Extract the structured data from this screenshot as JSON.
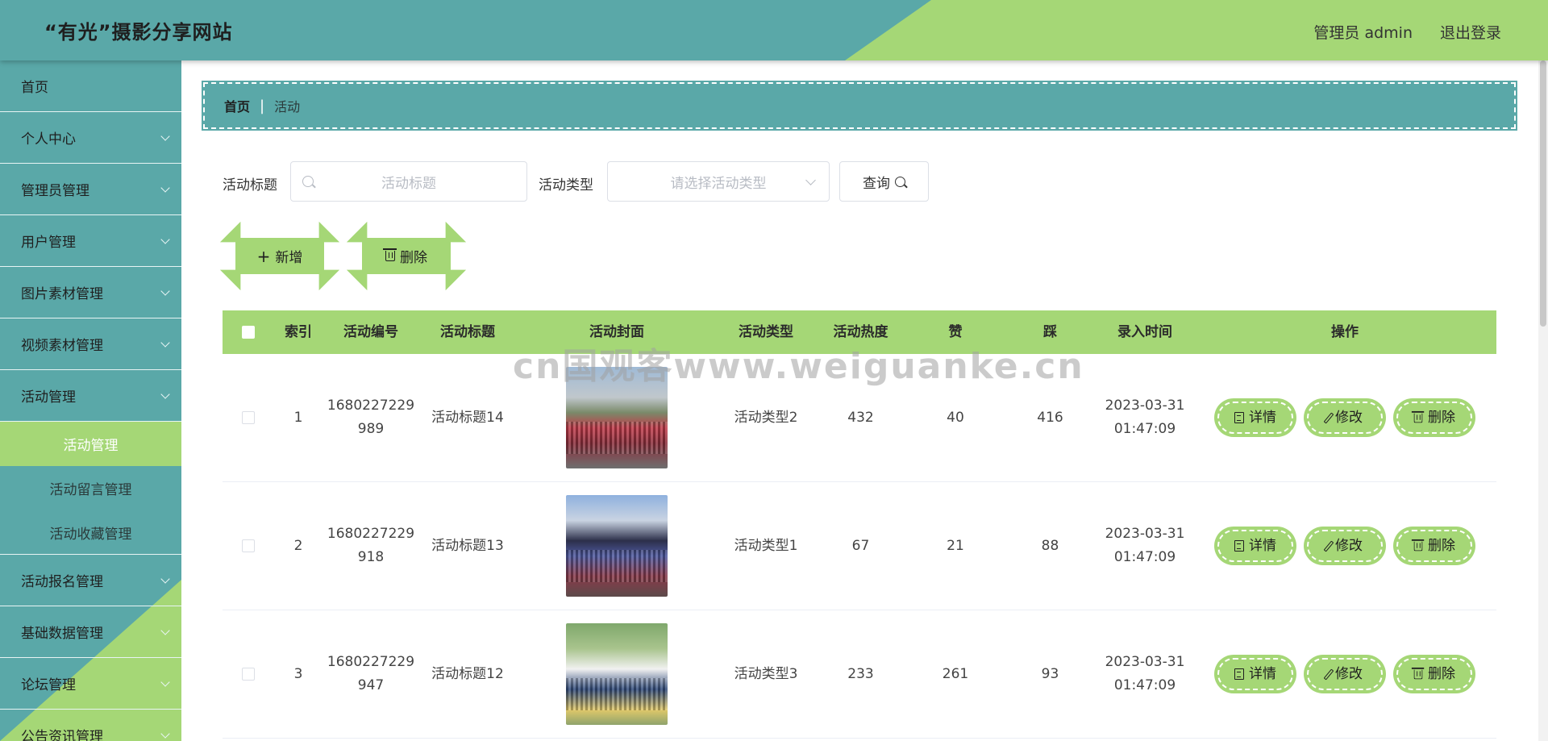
{
  "header": {
    "site_title": "“有光”摄影分享网站",
    "user_label": "管理员 admin",
    "logout": "退出登录"
  },
  "sidebar": {
    "items": [
      {
        "label": "首页",
        "has_children": false
      },
      {
        "label": "个人中心",
        "has_children": true
      },
      {
        "label": "管理员管理",
        "has_children": true
      },
      {
        "label": "用户管理",
        "has_children": true
      },
      {
        "label": "图片素材管理",
        "has_children": true
      },
      {
        "label": "视频素材管理",
        "has_children": true
      },
      {
        "label": "活动管理",
        "has_children": true
      }
    ],
    "subitems": [
      {
        "label": "活动管理",
        "active": true
      },
      {
        "label": "活动留言管理",
        "active": false
      },
      {
        "label": "活动收藏管理",
        "active": false
      }
    ],
    "items_after": [
      {
        "label": "活动报名管理",
        "has_children": true
      },
      {
        "label": "基础数据管理",
        "has_children": true
      },
      {
        "label": "论坛管理",
        "has_children": true
      },
      {
        "label": "公告资讯管理",
        "has_children": true
      }
    ]
  },
  "breadcrumb": {
    "home": "首页",
    "separator": "|",
    "current": "活动"
  },
  "search": {
    "title_label": "活动标题",
    "title_placeholder": "活动标题",
    "type_label": "活动类型",
    "type_placeholder": "请选择活动类型",
    "query_button": "查询"
  },
  "actions": {
    "add": "新增",
    "delete": "删除"
  },
  "table": {
    "columns": [
      "索引",
      "活动编号",
      "活动标题",
      "活动封面",
      "活动类型",
      "活动热度",
      "赞",
      "踩",
      "录入时间",
      "操作"
    ],
    "rows": [
      {
        "index": "1",
        "number_line1": "1680227229",
        "number_line2": "989",
        "title": "活动标题14",
        "type": "活动类型2",
        "hot": "432",
        "like": "40",
        "tread": "416",
        "date": "2023-03-31",
        "time": "01:47:09"
      },
      {
        "index": "2",
        "number_line1": "1680227229",
        "number_line2": "918",
        "title": "活动标题13",
        "type": "活动类型1",
        "hot": "67",
        "like": "21",
        "tread": "88",
        "date": "2023-03-31",
        "time": "01:47:09"
      },
      {
        "index": "3",
        "number_line1": "1680227229",
        "number_line2": "947",
        "title": "活动标题12",
        "type": "活动类型3",
        "hot": "233",
        "like": "261",
        "tread": "93",
        "date": "2023-03-31",
        "time": "01:47:09"
      }
    ],
    "op_labels": {
      "detail": "详情",
      "edit": "修改",
      "delete": "删除"
    }
  },
  "watermark": "cn国观客www.weiguanke.cn",
  "colors": {
    "teal": "#5aa8a8",
    "green": "#a5d776"
  }
}
